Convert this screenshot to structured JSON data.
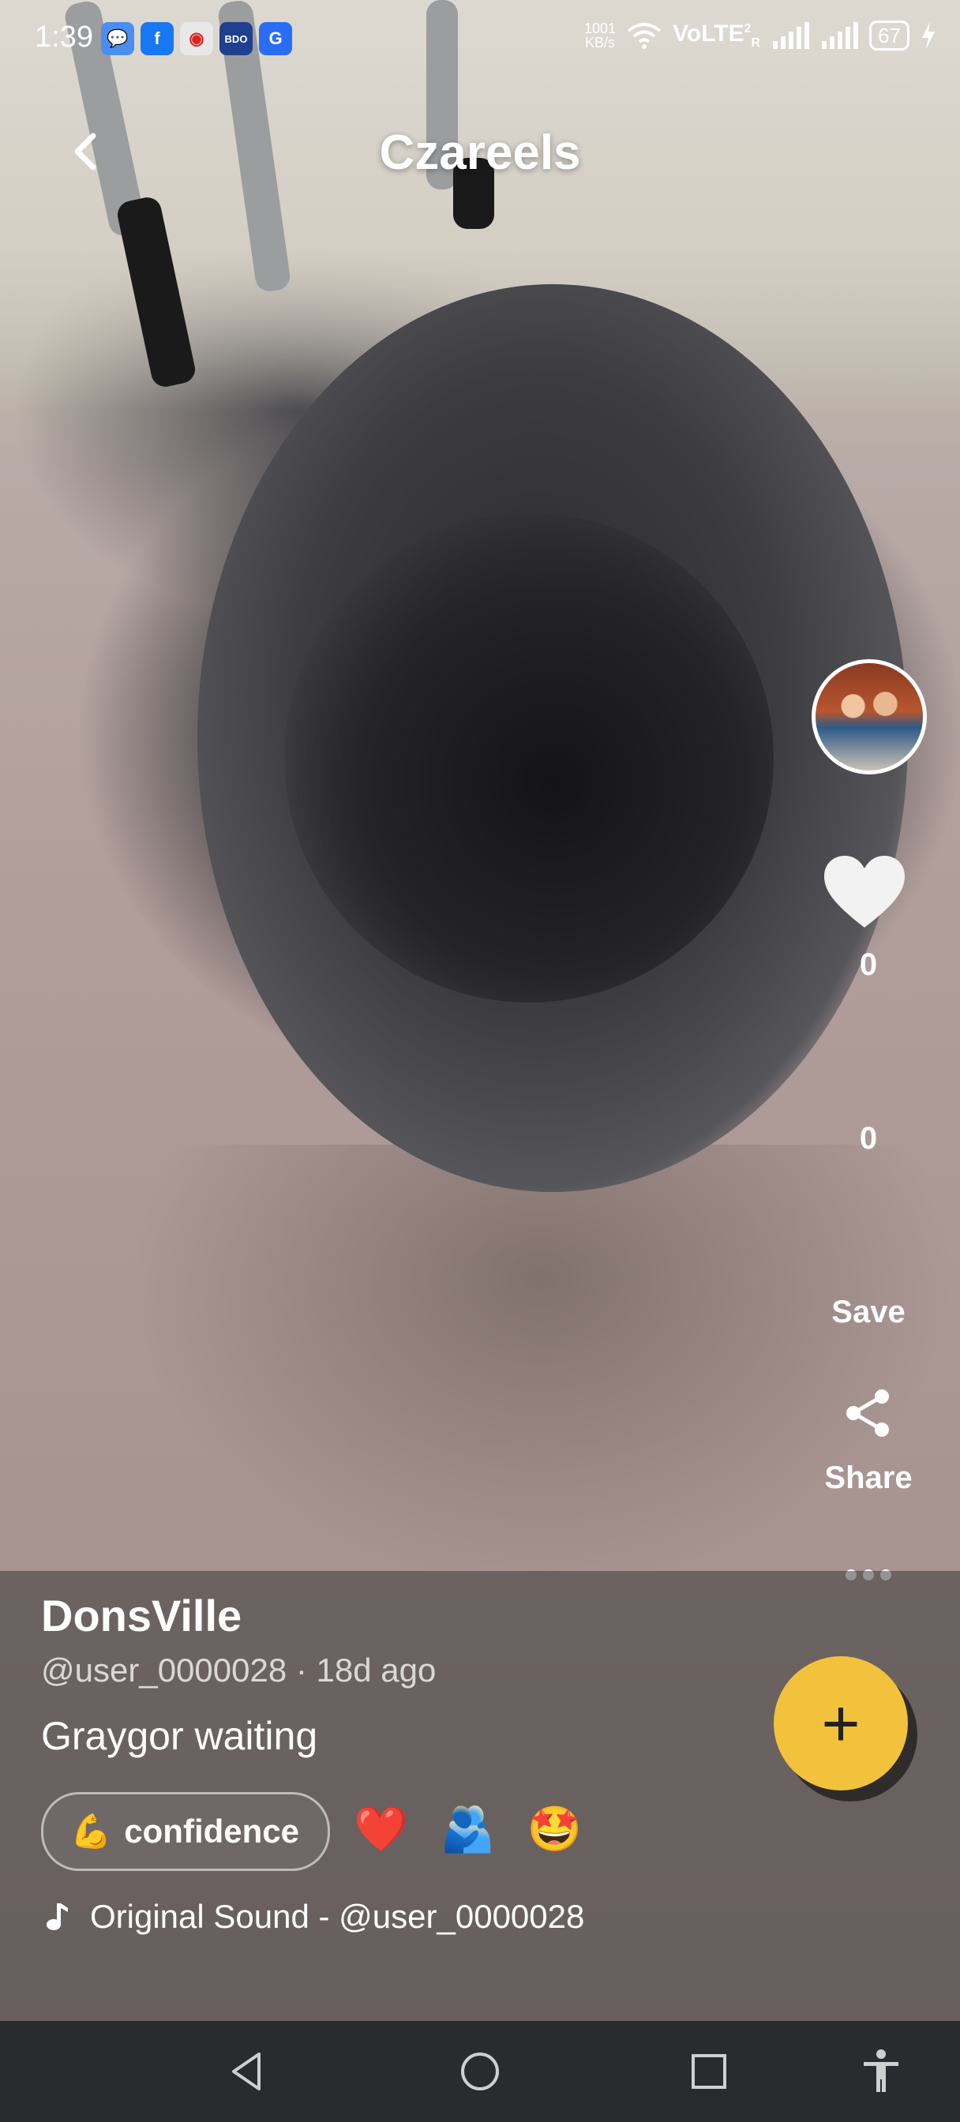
{
  "status_bar": {
    "time": "1:39",
    "net_speed_value": "1001",
    "net_speed_unit": "KB/s",
    "volte": "VoLTE",
    "volte_sup": "2",
    "volte_sub": "R",
    "battery": "67",
    "app_icons": [
      {
        "name": "messages-icon",
        "color": "#4a8ff0",
        "glyph": "💬"
      },
      {
        "name": "facebook-icon",
        "color": "#1877f2",
        "glyph": "f"
      },
      {
        "name": "gcash-icon",
        "color": "#e8e8e8",
        "glyph": "◉"
      },
      {
        "name": "bdo-icon",
        "color": "#1f3f8f",
        "glyph": "BDO"
      },
      {
        "name": "gcash-blue-icon",
        "color": "#2a6df5",
        "glyph": "G"
      }
    ]
  },
  "header": {
    "title": "Czareels"
  },
  "actions": {
    "like_count": "0",
    "comment_count": "0",
    "save_label": "Save",
    "share_label": "Share"
  },
  "post": {
    "username": "DonsVille",
    "handle": "@user_0000028",
    "time_ago": "18d ago",
    "caption": "Graygor waiting",
    "tag_emoji": "💪",
    "tag_label": "confidence",
    "reactions": [
      "❤️",
      "🫂",
      "🤩"
    ],
    "sound": "Original Sound - @user_0000028"
  },
  "colors": {
    "fab": "#f2c23c",
    "navbar": "#2a2b2f"
  }
}
